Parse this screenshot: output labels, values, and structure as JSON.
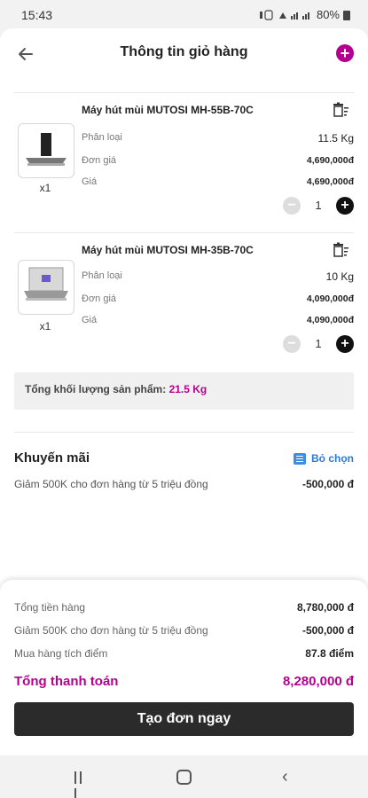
{
  "status_bar": {
    "time": "15:43",
    "battery": "80%"
  },
  "header": {
    "title": "Thông tin giỏ hàng",
    "add_label": "+"
  },
  "items": [
    {
      "name": "Máy hút mùi MUTOSI MH-55B-70C",
      "qty_label": "x1",
      "type_label": "Phân loại",
      "type_value": "11.5 Kg",
      "unit_price_label": "Đơn giá",
      "unit_price_value": "4,690,000đ",
      "price_label": "Giá",
      "price_value": "4,690,000đ",
      "quantity": "1"
    },
    {
      "name": "Máy hút mùi MUTOSI MH-35B-70C",
      "qty_label": "x1",
      "type_label": "Phân loại",
      "type_value": "10 Kg",
      "unit_price_label": "Đơn giá",
      "unit_price_value": "4,090,000đ",
      "price_label": "Giá",
      "price_value": "4,090,000đ",
      "quantity": "1"
    }
  ],
  "weight": {
    "label": "Tổng khối lượng sản phẩm:",
    "value": "21.5 Kg"
  },
  "promotion": {
    "title": "Khuyến mãi",
    "deselect_label": "Bỏ chọn",
    "line_label": "Giảm 500K cho đơn hàng từ 5 triệu đồng",
    "line_value": "-500,000 đ"
  },
  "summary": {
    "subtotal_label": "Tổng tiền hàng",
    "subtotal_value": "8,780,000 đ",
    "discount_label": "Giảm 500K cho đơn hàng từ 5 triệu đồng",
    "discount_value": "-500,000 đ",
    "points_label": "Mua hàng tích điểm",
    "points_value": "87.8 điểm",
    "total_label": "Tổng thanh toán",
    "total_value": "8,280,000 đ",
    "cta_label": "Tạo đơn ngay"
  },
  "colors": {
    "accent": "#b5008f",
    "link": "#2a7bd6",
    "cta": "#2b2b2b"
  },
  "icons": [
    "back-arrow-icon",
    "add-icon",
    "trash-icon",
    "minus-icon",
    "plus-icon",
    "list-icon"
  ]
}
